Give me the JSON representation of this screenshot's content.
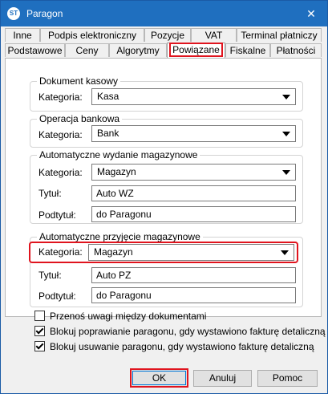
{
  "window": {
    "title": "Paragon",
    "app_icon": "ST"
  },
  "tabs_row1": [
    "Inne",
    "Podpis elektroniczny",
    "Pozycje",
    "VAT",
    "Terminal płatniczy"
  ],
  "tabs_row2": [
    "Podstawowe",
    "Ceny",
    "Algorytmy",
    "Powiązane",
    "Fiskalne",
    "Płatności"
  ],
  "active_tab": "Powiązane",
  "groups": {
    "dokument_kasowy": {
      "title": "Dokument kasowy",
      "kategoria_label": "Kategoria:",
      "kategoria_value": "Kasa"
    },
    "operacja_bankowa": {
      "title": "Operacja bankowa",
      "kategoria_label": "Kategoria:",
      "kategoria_value": "Bank"
    },
    "wydanie": {
      "title": "Automatyczne wydanie magazynowe",
      "kategoria_label": "Kategoria:",
      "kategoria_value": "Magazyn",
      "tytul_label": "Tytuł:",
      "tytul_value": "Auto WZ",
      "podtytul_label": "Podtytuł:",
      "podtytul_value": "do Paragonu"
    },
    "przyjecie": {
      "title": "Automatyczne przyjęcie magazynowe",
      "kategoria_label": "Kategoria:",
      "kategoria_value": "Magazyn",
      "tytul_label": "Tytuł:",
      "tytul_value": "Auto PZ",
      "podtytul_label": "Podtytuł:",
      "podtytul_value": "do Paragonu"
    }
  },
  "checkboxes": [
    {
      "label": "Przenoś uwagi między dokumentami",
      "checked": false
    },
    {
      "label": "Blokuj poprawianie paragonu, gdy wystawiono fakturę detaliczną",
      "checked": true
    },
    {
      "label": "Blokuj usuwanie paragonu, gdy wystawiono fakturę detaliczną",
      "checked": true
    }
  ],
  "buttons": {
    "ok": "OK",
    "cancel": "Anuluj",
    "help": "Pomoc"
  },
  "colors": {
    "titlebar": "#1f6fbf",
    "highlight": "#e0141e"
  }
}
